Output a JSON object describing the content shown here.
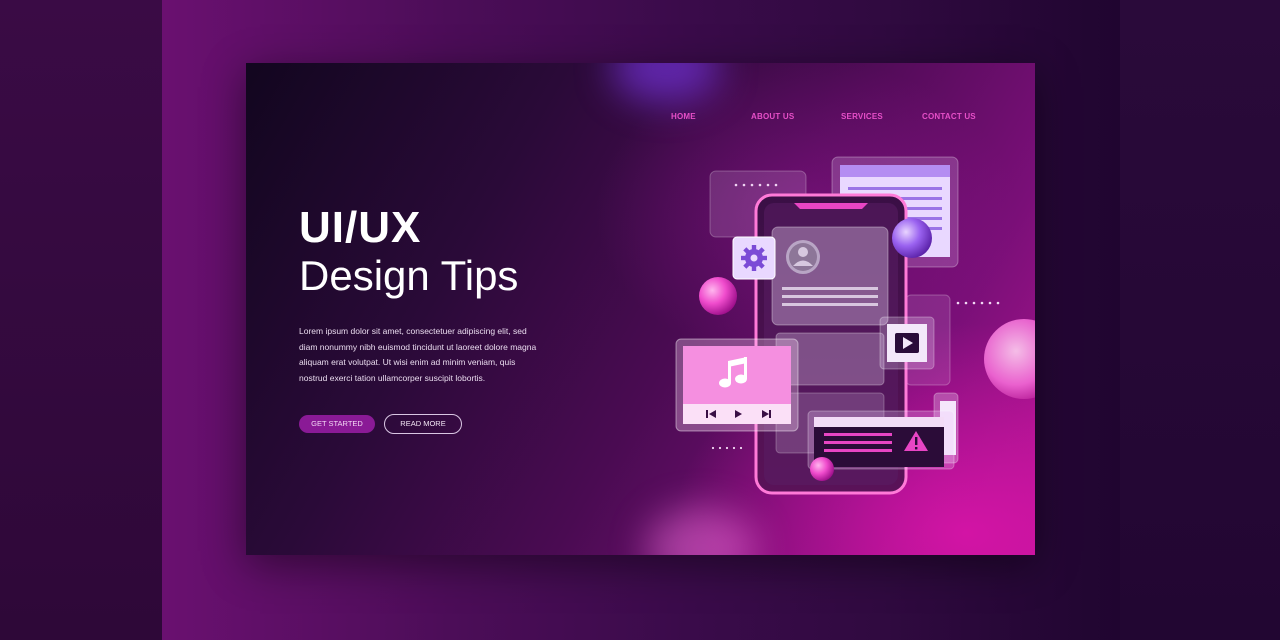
{
  "nav": {
    "items": [
      {
        "label": "HOME"
      },
      {
        "label": "ABOUT US"
      },
      {
        "label": "SERVICES"
      },
      {
        "label": "CONTACT US"
      }
    ]
  },
  "hero": {
    "title_line1": "UI/UX",
    "title_line2": "Design Tips",
    "body_lines": [
      "Lorem ipsum dolor sit amet, consectetuer adipiscing elit, sed",
      "diam nonummy nibh euismod tincidunt ut laoreet dolore magna",
      "aliquam erat volutpat. Ut wisi enim ad minim veniam, quis",
      "nostrud exerci tation ullamcorper suscipit lobortis."
    ],
    "primary_button": "GET STARTED",
    "secondary_button": "READ MORE"
  },
  "illustration": {
    "icons": [
      "gear-icon",
      "avatar-icon",
      "play-icon",
      "music-note-icon",
      "previous-icon",
      "play-small-icon",
      "next-icon",
      "warning-icon"
    ],
    "accent_color": "#e64fc8",
    "glow_color": "#c21a9c"
  }
}
